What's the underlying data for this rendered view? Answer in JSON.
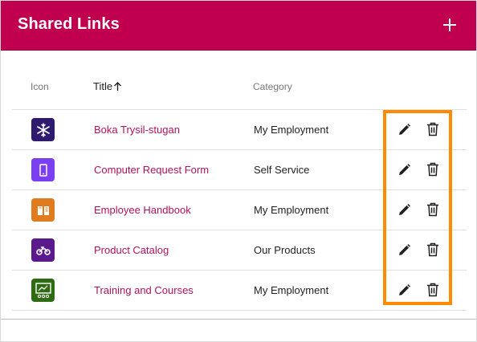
{
  "header": {
    "title": "Shared Links"
  },
  "columns": {
    "icon": "Icon",
    "title": "Title",
    "category": "Category"
  },
  "rows": [
    {
      "title": "Boka Trysil-stugan",
      "category": "My Employment",
      "icon": "snowflake-icon",
      "color": "#2e1a6e"
    },
    {
      "title": "Computer Request Form",
      "category": "Self Service",
      "icon": "tablet-icon",
      "color": "#7b3ff2"
    },
    {
      "title": "Employee Handbook",
      "category": "My Employment",
      "icon": "book-icon",
      "color": "#e07b20"
    },
    {
      "title": "Product Catalog",
      "category": "Our Products",
      "icon": "motorcycle-icon",
      "color": "#5a1a8c"
    },
    {
      "title": "Training and Courses",
      "category": "My Employment",
      "icon": "presentation-board-icon",
      "color": "#2e6b12"
    }
  ],
  "colors": {
    "header": "#c0004f",
    "link": "#b0115f",
    "highlight": "#ff8a00"
  }
}
